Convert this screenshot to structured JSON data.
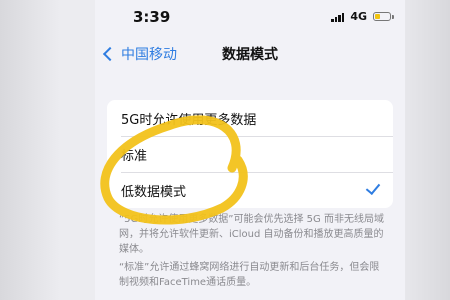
{
  "status_bar": {
    "time": "3:39",
    "network": "4G"
  },
  "nav": {
    "back_label": "中国移动",
    "title": "数据模式"
  },
  "options": [
    {
      "label": "5G时允许使用更多数据",
      "selected": false
    },
    {
      "label": "标准",
      "selected": false
    },
    {
      "label": "低数据模式",
      "selected": true
    }
  ],
  "footnotes": [
    "“5G时允许使用更多数据”可能会优先选择 5G 而非无线局域网，并将允许软件更新、iCloud 自动备份和播放更高质量的媒体。",
    "“标准”允许通过蜂窝网络进行自动更新和后台任务，但会限制视频和FaceTime通话质量。"
  ],
  "colors": {
    "accent": "#2f7de1",
    "annotation": "#f2c21b",
    "background": "#f2f2f7"
  }
}
